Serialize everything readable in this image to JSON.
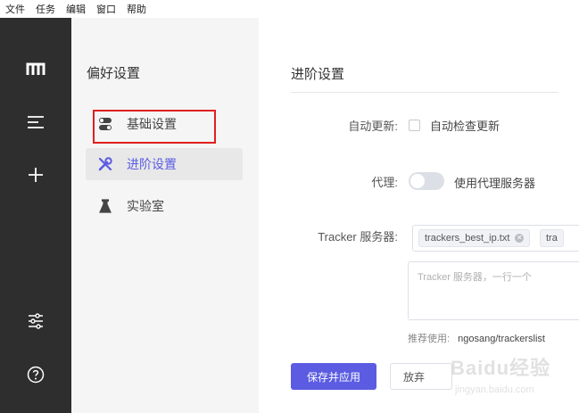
{
  "menubar": {
    "items": [
      "文件",
      "任务",
      "编辑",
      "窗口",
      "帮助"
    ]
  },
  "rail": {
    "icons": [
      "logo-icon",
      "task-list-icon",
      "add-icon",
      "preferences-icon",
      "help-icon"
    ]
  },
  "prefs": {
    "title": "偏好设置",
    "items": [
      {
        "label": "基础设置",
        "icon": "basic-settings-icon"
      },
      {
        "label": "进阶设置",
        "icon": "tools-icon"
      },
      {
        "label": "实验室",
        "icon": "flask-icon"
      }
    ],
    "active_index": 1
  },
  "main": {
    "title": "进阶设置",
    "auto_update": {
      "label": "自动更新:",
      "option": "自动检查更新",
      "checked": false
    },
    "proxy": {
      "label": "代理:",
      "option": "使用代理服务器",
      "enabled": false
    },
    "tracker": {
      "label": "Tracker 服务器:",
      "tags": [
        "trackers_best_ip.txt",
        "tra"
      ],
      "placeholder": "Tracker 服务器，一行一个",
      "hint_prefix": "推荐使用:",
      "hint_link": "ngosang/trackerslist"
    },
    "buttons": {
      "save": "保存并应用",
      "discard": "放弃"
    }
  },
  "watermark": {
    "text": "Baidu经验",
    "sub": "jingyan.baidu.com"
  },
  "colors": {
    "accent": "#5b5ce2",
    "rail": "#2e2e2e",
    "sidebar": "#f5f5f5",
    "highlight": "#e02020"
  }
}
